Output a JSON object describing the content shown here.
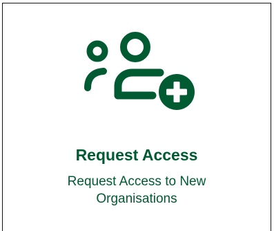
{
  "card": {
    "icon": "user-group-add-icon",
    "title": "Request Access",
    "description_line1": "Request Access to New",
    "description_line2": "Organisations"
  },
  "colors": {
    "brand_green": "#005a32",
    "border": "#111111",
    "background": "#ffffff"
  }
}
